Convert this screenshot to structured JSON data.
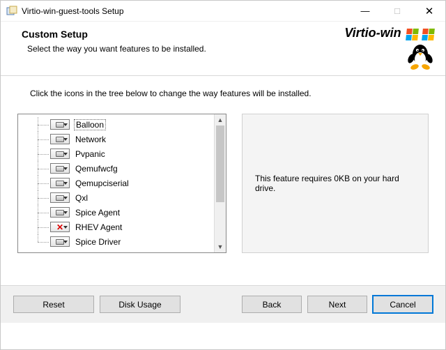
{
  "window": {
    "title": "Virtio-win-guest-tools Setup"
  },
  "header": {
    "title": "Custom Setup",
    "subtitle": "Select the way you want features to be installed.",
    "brand": "Virtio-win"
  },
  "body": {
    "instruction": "Click the icons in the tree below to change the way features will be installed.",
    "description": "This feature requires 0KB on your hard drive."
  },
  "tree": {
    "items": [
      {
        "label": "Balloon",
        "icon": "disk",
        "selected": true
      },
      {
        "label": "Network",
        "icon": "disk",
        "selected": false
      },
      {
        "label": "Pvpanic",
        "icon": "disk",
        "selected": false
      },
      {
        "label": "Qemufwcfg",
        "icon": "disk",
        "selected": false
      },
      {
        "label": "Qemupciserial",
        "icon": "disk",
        "selected": false
      },
      {
        "label": "Qxl",
        "icon": "disk",
        "selected": false
      },
      {
        "label": "Spice Agent",
        "icon": "disk",
        "selected": false
      },
      {
        "label": "RHEV Agent",
        "icon": "x",
        "selected": false
      },
      {
        "label": "Spice Driver",
        "icon": "disk",
        "selected": false
      }
    ]
  },
  "buttons": {
    "reset": "Reset",
    "disk_usage": "Disk Usage",
    "back": "Back",
    "next": "Next",
    "cancel": "Cancel"
  }
}
